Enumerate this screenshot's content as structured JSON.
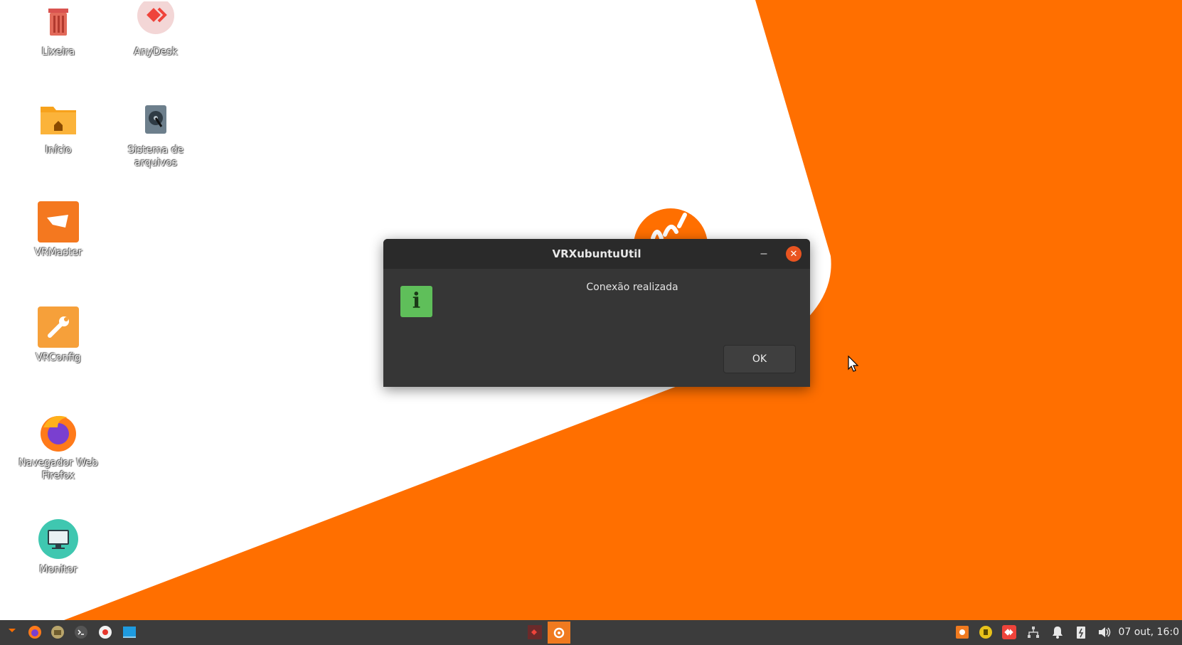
{
  "desktop": {
    "icons": [
      {
        "label": "Lixeira",
        "icon": "trash-icon"
      },
      {
        "label": "AnyDesk",
        "icon": "anydesk-icon"
      },
      {
        "label": "Início",
        "icon": "home-folder-icon"
      },
      {
        "label": "Sistema de arquivos",
        "icon": "filesystem-icon"
      },
      {
        "label": "VRMaster",
        "icon": "vrmaster-icon"
      },
      {
        "label": "VRConfig",
        "icon": "vrconfig-icon"
      },
      {
        "label": "Navegador Web Firefox",
        "icon": "firefox-icon"
      },
      {
        "label": "Monitor",
        "icon": "monitor-icon"
      }
    ],
    "colors": {
      "wallpaper_orange": "#ff6f00",
      "wallpaper_white": "#ffffff"
    }
  },
  "dialog": {
    "title": "VRXubuntuUtil",
    "minimize_glyph": "–",
    "close_glyph": "✕",
    "info_glyph": "i",
    "message": "Conexão realizada",
    "ok_label": "OK"
  },
  "taskbar": {
    "left_launchers": [
      "menu-icon",
      "firefox-icon",
      "files-icon",
      "terminal-icon",
      "screenshot-icon",
      "desktop-icon"
    ],
    "center_windows": [
      "anydesk-window-icon",
      "vrxubuntuutil-window-icon"
    ],
    "tray": [
      "update-icon",
      "security-icon",
      "anydesk-tray-icon",
      "network-icon",
      "notifications-icon",
      "power-icon",
      "volume-icon"
    ],
    "clock": "07 out, 16:0"
  }
}
